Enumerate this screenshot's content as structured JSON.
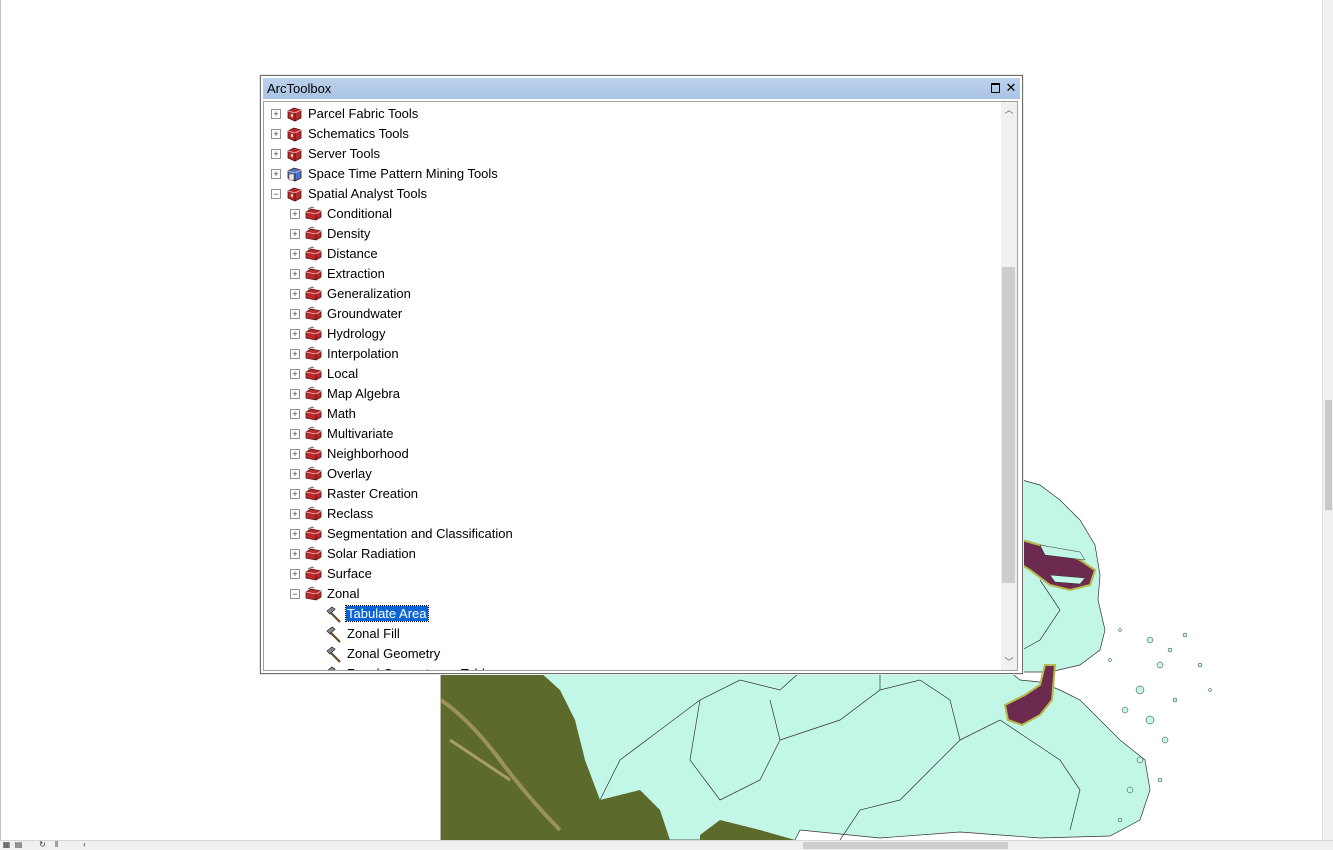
{
  "window": {
    "title": "ArcToolbox",
    "maximize_label": "maximize",
    "close_label": "✕"
  },
  "tree": [
    {
      "label": "Parcel Fabric Tools",
      "level": 0,
      "expander": "+",
      "icon": "toolbox-icon"
    },
    {
      "label": "Schematics Tools",
      "level": 0,
      "expander": "+",
      "icon": "toolbox-icon"
    },
    {
      "label": "Server Tools",
      "level": 0,
      "expander": "+",
      "icon": "toolbox-icon"
    },
    {
      "label": "Space Time Pattern Mining Tools",
      "level": 0,
      "expander": "+",
      "icon": "toolbox-blue-icon"
    },
    {
      "label": "Spatial Analyst Tools",
      "level": 0,
      "expander": "−",
      "icon": "toolbox-icon"
    },
    {
      "label": "Conditional",
      "level": 1,
      "expander": "+",
      "icon": "toolset-icon"
    },
    {
      "label": "Density",
      "level": 1,
      "expander": "+",
      "icon": "toolset-icon"
    },
    {
      "label": "Distance",
      "level": 1,
      "expander": "+",
      "icon": "toolset-icon"
    },
    {
      "label": "Extraction",
      "level": 1,
      "expander": "+",
      "icon": "toolset-icon"
    },
    {
      "label": "Generalization",
      "level": 1,
      "expander": "+",
      "icon": "toolset-icon"
    },
    {
      "label": "Groundwater",
      "level": 1,
      "expander": "+",
      "icon": "toolset-icon"
    },
    {
      "label": "Hydrology",
      "level": 1,
      "expander": "+",
      "icon": "toolset-icon"
    },
    {
      "label": "Interpolation",
      "level": 1,
      "expander": "+",
      "icon": "toolset-icon"
    },
    {
      "label": "Local",
      "level": 1,
      "expander": "+",
      "icon": "toolset-icon"
    },
    {
      "label": "Map Algebra",
      "level": 1,
      "expander": "+",
      "icon": "toolset-icon"
    },
    {
      "label": "Math",
      "level": 1,
      "expander": "+",
      "icon": "toolset-icon"
    },
    {
      "label": "Multivariate",
      "level": 1,
      "expander": "+",
      "icon": "toolset-icon"
    },
    {
      "label": "Neighborhood",
      "level": 1,
      "expander": "+",
      "icon": "toolset-icon"
    },
    {
      "label": "Overlay",
      "level": 1,
      "expander": "+",
      "icon": "toolset-icon"
    },
    {
      "label": "Raster Creation",
      "level": 1,
      "expander": "+",
      "icon": "toolset-icon"
    },
    {
      "label": "Reclass",
      "level": 1,
      "expander": "+",
      "icon": "toolset-icon"
    },
    {
      "label": "Segmentation and Classification",
      "level": 1,
      "expander": "+",
      "icon": "toolset-icon"
    },
    {
      "label": "Solar Radiation",
      "level": 1,
      "expander": "+",
      "icon": "toolset-icon"
    },
    {
      "label": "Surface",
      "level": 1,
      "expander": "+",
      "icon": "toolset-icon"
    },
    {
      "label": "Zonal",
      "level": 1,
      "expander": "−",
      "icon": "toolset-icon"
    },
    {
      "label": "Tabulate Area",
      "level": 2,
      "expander": "",
      "icon": "hammer-icon",
      "selected": true
    },
    {
      "label": "Zonal Fill",
      "level": 2,
      "expander": "",
      "icon": "hammer-icon"
    },
    {
      "label": "Zonal Geometry",
      "level": 2,
      "expander": "",
      "icon": "hammer-icon"
    },
    {
      "label": "Zonal Geometry as Table",
      "level": 2,
      "expander": "",
      "icon": "hammer-icon"
    }
  ],
  "colors": {
    "titlebar": "#b3cbe9",
    "selection": "#0a64d6",
    "map_land": "#c2f6e6",
    "map_raster": "#5c6b2c",
    "map_water_highlight": "#6b2a4e"
  }
}
